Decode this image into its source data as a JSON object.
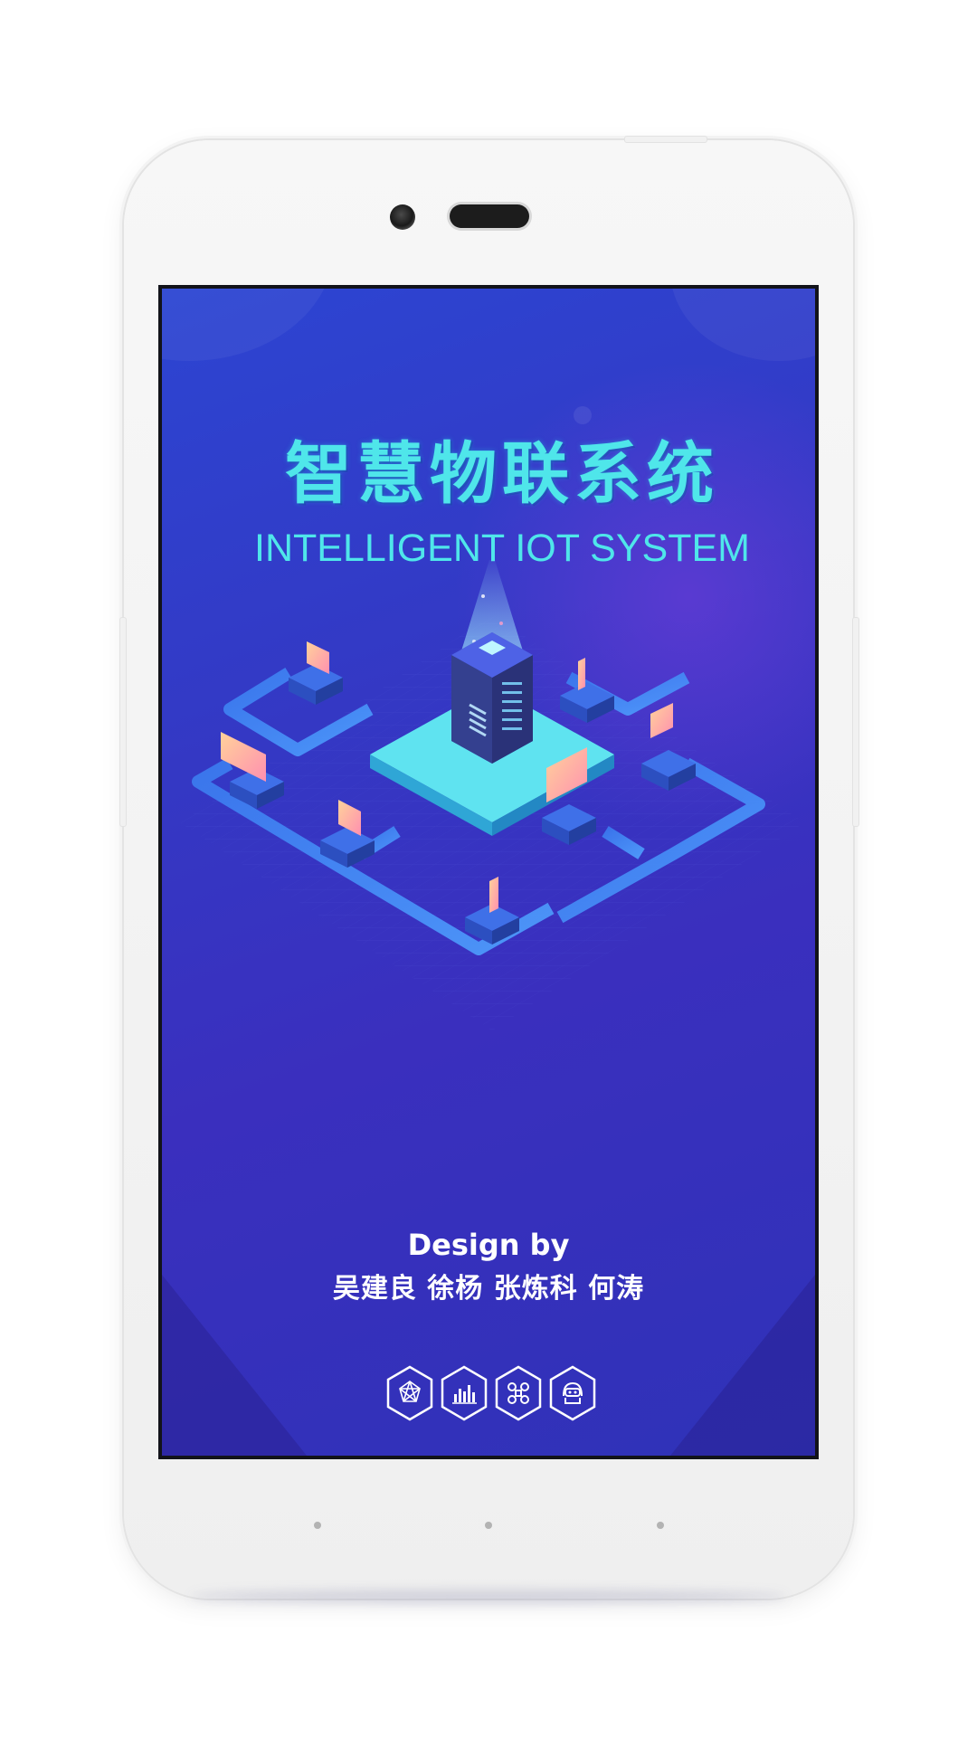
{
  "splash": {
    "title_cn": "智慧物联系统",
    "title_en": "INTELLIGENT IOT SYSTEM",
    "credits_heading": "Design by",
    "credits_names": "吴建良 徐杨 张炼科 何涛"
  },
  "bottom_icons": [
    {
      "name": "network-icon"
    },
    {
      "name": "bar-chart-icon"
    },
    {
      "name": "command-icon"
    },
    {
      "name": "robot-icon"
    }
  ],
  "colors": {
    "accent_cyan": "#4fe6ea",
    "background_blue": "#3438c4",
    "platform_cyan": "#5fe3f0",
    "screen_peach": "#ffc59a",
    "screen_pink": "#ff8fb0"
  }
}
